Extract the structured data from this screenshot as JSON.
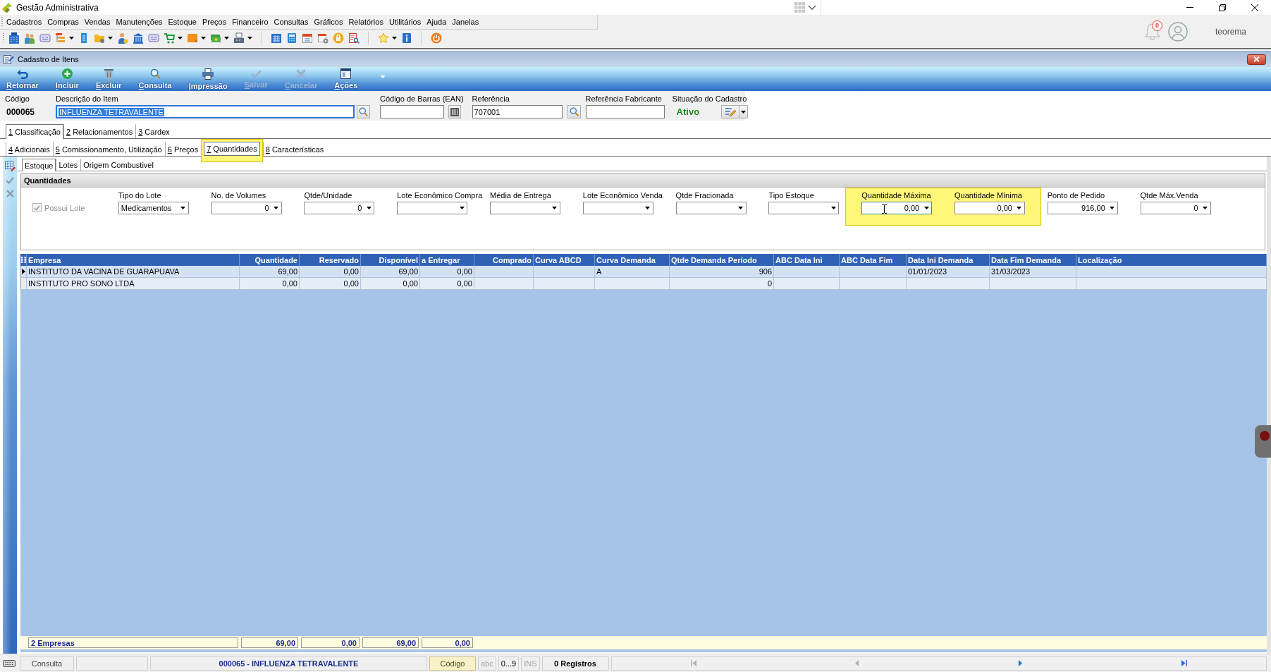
{
  "app": {
    "title": "Gestão Administrativa"
  },
  "menu": [
    "Cadastros",
    "Compras",
    "Vendas",
    "Manutenções",
    "Estoque",
    "Preços",
    "Financeiro",
    "Consultas",
    "Gráficos",
    "Relatórios",
    "Utilitários",
    "Ajuda",
    "Janelas"
  ],
  "notifications": {
    "count": "0"
  },
  "user": {
    "name": "teorema"
  },
  "window": {
    "title": "Cadastro de Itens"
  },
  "ribbon": [
    {
      "kind": "back",
      "label": "Retornar",
      "disabled": false
    },
    {
      "kind": "add",
      "label": "Incluir",
      "disabled": false
    },
    {
      "kind": "delete",
      "label": "Excluir",
      "disabled": false
    },
    {
      "kind": "search",
      "label": "Consulta",
      "disabled": false
    },
    {
      "kind": "print",
      "label": "Impressão",
      "disabled": false
    },
    {
      "kind": "save",
      "label": "Salvar",
      "disabled": true
    },
    {
      "kind": "cancel",
      "label": "Cancelar",
      "disabled": true
    },
    {
      "kind": "actions",
      "label": "Ações",
      "disabled": false
    }
  ],
  "item": {
    "code": {
      "label": "Código",
      "value": "000065"
    },
    "description": {
      "label": "Descrição do Item",
      "value": "INFLUENZA TETRAVALENTE",
      "selected": true
    },
    "barcode": {
      "label": "Código de Barras (EAN)"
    },
    "reference": {
      "label": "Referência",
      "value": "707001"
    },
    "manufacturer_reference": {
      "label": "Referência Fabricante"
    },
    "status": {
      "label": "Situação do Cadastro",
      "value": "Ativo"
    }
  },
  "tabs_primary": [
    {
      "label": "1 Classificação",
      "selected": true
    },
    {
      "label": "2 Relacionamentos",
      "selected": false
    },
    {
      "label": "3 Cardex",
      "selected": false
    }
  ],
  "tabs_secondary": [
    {
      "label": "4 Adicionais",
      "selected": false,
      "highlighted": false
    },
    {
      "label": "5 Comissionamento, Utilização",
      "selected": false,
      "highlighted": false
    },
    {
      "label": "6 Preços",
      "selected": false,
      "highlighted": false
    },
    {
      "label": "7 Quantidades",
      "selected": true,
      "highlighted": true
    },
    {
      "label": "8 Características",
      "selected": false,
      "highlighted": false
    }
  ],
  "subtabs": [
    {
      "label": "Estoque",
      "selected": true
    },
    {
      "label": "Lotes",
      "selected": false
    },
    {
      "label": "Origem Combustivel",
      "selected": false
    }
  ],
  "quantities": {
    "title": "Quantidades",
    "fields": [
      {
        "kind": "checkbox",
        "label": "Possui Lote",
        "checked": true,
        "disabled": true,
        "highlighted": false,
        "focused": false
      },
      {
        "kind": "text_combo",
        "label": "Tipo do Lote",
        "value": "Medicamentos",
        "highlighted": false,
        "focused": false
      },
      {
        "kind": "number_combo",
        "label": "No. de Volumes",
        "value": "0",
        "highlighted": false,
        "focused": false
      },
      {
        "kind": "number_combo",
        "label": "Qtde/Unidade",
        "value": "0",
        "highlighted": false,
        "focused": false
      },
      {
        "kind": "text_combo",
        "label": "Lote Econômico Compra",
        "highlighted": false,
        "focused": false
      },
      {
        "kind": "text_combo",
        "label": "Média de Entrega",
        "highlighted": false,
        "focused": false
      },
      {
        "kind": "text_combo",
        "label": "Lote Econômico Venda",
        "highlighted": false,
        "focused": false
      },
      {
        "kind": "text_combo",
        "label": "Qtde Fracionada",
        "highlighted": false,
        "focused": false
      },
      {
        "kind": "text_combo",
        "label": "Tipo Estoque",
        "highlighted": false,
        "focused": false
      },
      {
        "kind": "number_combo",
        "label": "Quantidade Máxima",
        "value": "0,00",
        "highlighted": true,
        "focused": true
      },
      {
        "kind": "number_combo",
        "label": "Quantidade Mínima",
        "value": "0,00",
        "highlighted": true,
        "focused": false
      },
      {
        "kind": "number_combo",
        "label": "Ponto de Pedido",
        "value": "916,00",
        "highlighted": false,
        "focused": false
      },
      {
        "kind": "number_combo",
        "label": "Qtde Máx.Venda",
        "value": "0",
        "highlighted": false,
        "focused": false
      }
    ]
  },
  "grid": {
    "columns": [
      {
        "label": "Empresa",
        "kind": "text"
      },
      {
        "label": "Quantidade",
        "kind": "number"
      },
      {
        "label": "Reservado",
        "kind": "number"
      },
      {
        "label": "Disponível",
        "kind": "number"
      },
      {
        "label": "a Entregar",
        "kind": "amount"
      },
      {
        "label": "Comprado",
        "kind": "number"
      },
      {
        "label": "Curva ABCD",
        "kind": "text"
      },
      {
        "label": "Curva Demanda",
        "kind": "text"
      },
      {
        "label": "Qtde Demanda Período",
        "kind": "amount"
      },
      {
        "label": "ABC Data Ini",
        "kind": "text"
      },
      {
        "label": "ABC Data Fim",
        "kind": "text"
      },
      {
        "label": "Data Ini Demanda",
        "kind": "text"
      },
      {
        "label": "Data Fim Demanda",
        "kind": "text"
      },
      {
        "label": "Localização",
        "kind": "text"
      }
    ],
    "rows": [
      {
        "selected": true,
        "cells": [
          "INSTITUTO DA VACINA DE GUARAPUAVA",
          "69,00",
          "0,00",
          "69,00",
          "0,00",
          null,
          null,
          "A",
          "906",
          null,
          null,
          "01/01/2023",
          "31/03/2023",
          null
        ]
      },
      {
        "selected": false,
        "cells": [
          "INSTITUTO PRO SONO LTDA",
          "0,00",
          "0,00",
          "0,00",
          "0,00",
          null,
          null,
          null,
          "0",
          null,
          null,
          null,
          null,
          null
        ]
      }
    ],
    "footer": {
      "label": "2 Empresas",
      "totals": [
        "69,00",
        "0,00",
        "69,00",
        "0,00"
      ]
    }
  },
  "status_bar": {
    "mode": "Consulta",
    "record": "000065 - INFLUENZA TETRAVALENTE",
    "sort_field": "Código",
    "indicators": [
      {
        "label": "abc",
        "on": false
      },
      {
        "label": "0...9",
        "on": true
      },
      {
        "label": "INS",
        "on": false
      }
    ],
    "records": "0 Registros",
    "navigation": [
      {
        "kind": "first",
        "disabled": true
      },
      {
        "kind": "previous",
        "disabled": true
      },
      {
        "kind": "next",
        "disabled": false
      },
      {
        "kind": "last",
        "disabled": false
      }
    ]
  }
}
